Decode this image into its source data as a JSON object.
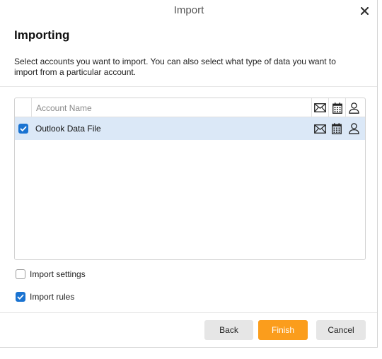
{
  "window": {
    "title": "Import"
  },
  "page": {
    "heading": "Importing",
    "description": "Select accounts you want to import. You can also select what type of data you want to import from a particular account."
  },
  "table": {
    "column_header": "Account Name",
    "columns": [
      {
        "icon": "mail-icon"
      },
      {
        "icon": "calendar-icon"
      },
      {
        "icon": "contact-icon"
      }
    ],
    "rows": [
      {
        "name": "Outlook Data File",
        "checked": true,
        "selected": true
      }
    ]
  },
  "options": {
    "import_settings": {
      "label": "Import settings",
      "checked": false
    },
    "import_rules": {
      "label": "Import rules",
      "checked": true
    }
  },
  "buttons": {
    "back": "Back",
    "finish": "Finish",
    "cancel": "Cancel"
  },
  "colors": {
    "accent": "#1a73d1",
    "selection": "#dbe8f7",
    "finish_button": "#fb9d1c",
    "secondary_button": "#e6e6e6"
  }
}
